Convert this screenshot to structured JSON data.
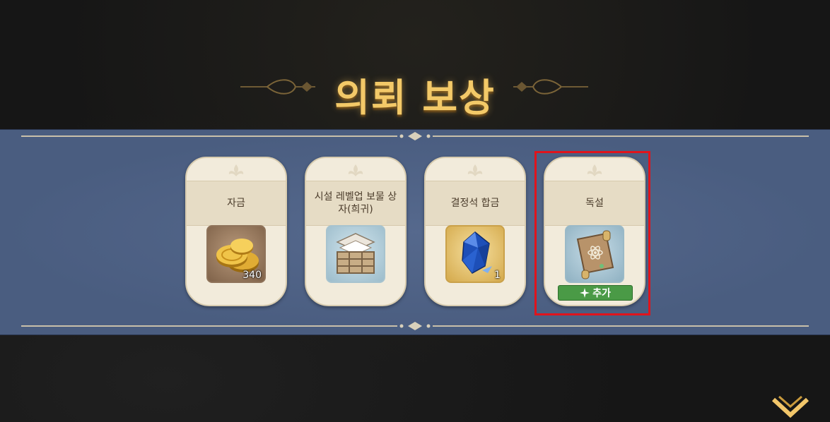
{
  "screen": {
    "title": "의뢰 보상",
    "rewards": [
      {
        "label": "자금",
        "icon": "gold-coins-icon",
        "quantity": "340",
        "badge": ""
      },
      {
        "label": "시설 레벨업 보물 상자(희귀)",
        "icon": "treasure-chest-icon",
        "quantity": "",
        "badge": ""
      },
      {
        "label": "결정석 합금",
        "icon": "crystal-icon",
        "quantity": "1",
        "badge": ""
      },
      {
        "label": "독설",
        "icon": "scroll-icon",
        "quantity": "",
        "badge": "추가"
      }
    ],
    "highlighted_reward": "독설"
  },
  "colors": {
    "title": "#f3c968",
    "band": "#4a5d80",
    "card": "#f2ebdb",
    "badge": "#4a9a46",
    "highlight": "#e0141c"
  }
}
